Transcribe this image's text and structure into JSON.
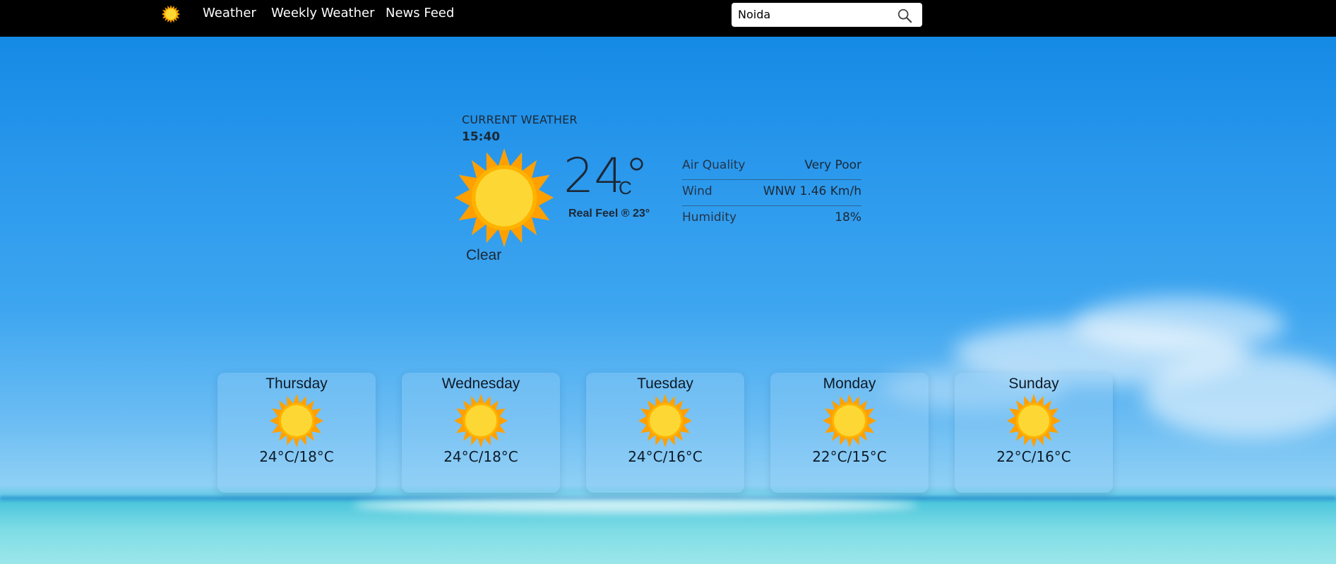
{
  "navbar": {
    "links": [
      "Weather",
      "Weekly Weather",
      "News Feed"
    ],
    "search": {
      "value": "Noida",
      "placeholder": ""
    }
  },
  "current": {
    "label": "CURRENT WEATHER",
    "time": "15:40",
    "temperature": "24°",
    "unit": "C",
    "real_feel": "Real Feel ® 23°",
    "condition": "Clear",
    "icon": "sun-icon",
    "details": [
      {
        "label": "Air Quality",
        "value": "Very Poor"
      },
      {
        "label": "Wind",
        "value": "WNW 1.46 Km/h"
      },
      {
        "label": "Humidity",
        "value": "18%"
      }
    ]
  },
  "forecast": [
    {
      "day": "Thursday",
      "range": "24°C/18°C",
      "icon": "sun-icon"
    },
    {
      "day": "Wednesday",
      "range": "24°C/18°C",
      "icon": "sun-icon"
    },
    {
      "day": "Tuesday",
      "range": "24°C/16°C",
      "icon": "sun-icon"
    },
    {
      "day": "Monday",
      "range": "22°C/15°C",
      "icon": "sun-icon"
    },
    {
      "day": "Sunday",
      "range": "22°C/16°C",
      "icon": "sun-icon"
    }
  ],
  "colors": {
    "navbar": "#000000",
    "sun_core": "#FDD835",
    "sun_rays": "#FFA000",
    "sky": "#2a98ec"
  }
}
